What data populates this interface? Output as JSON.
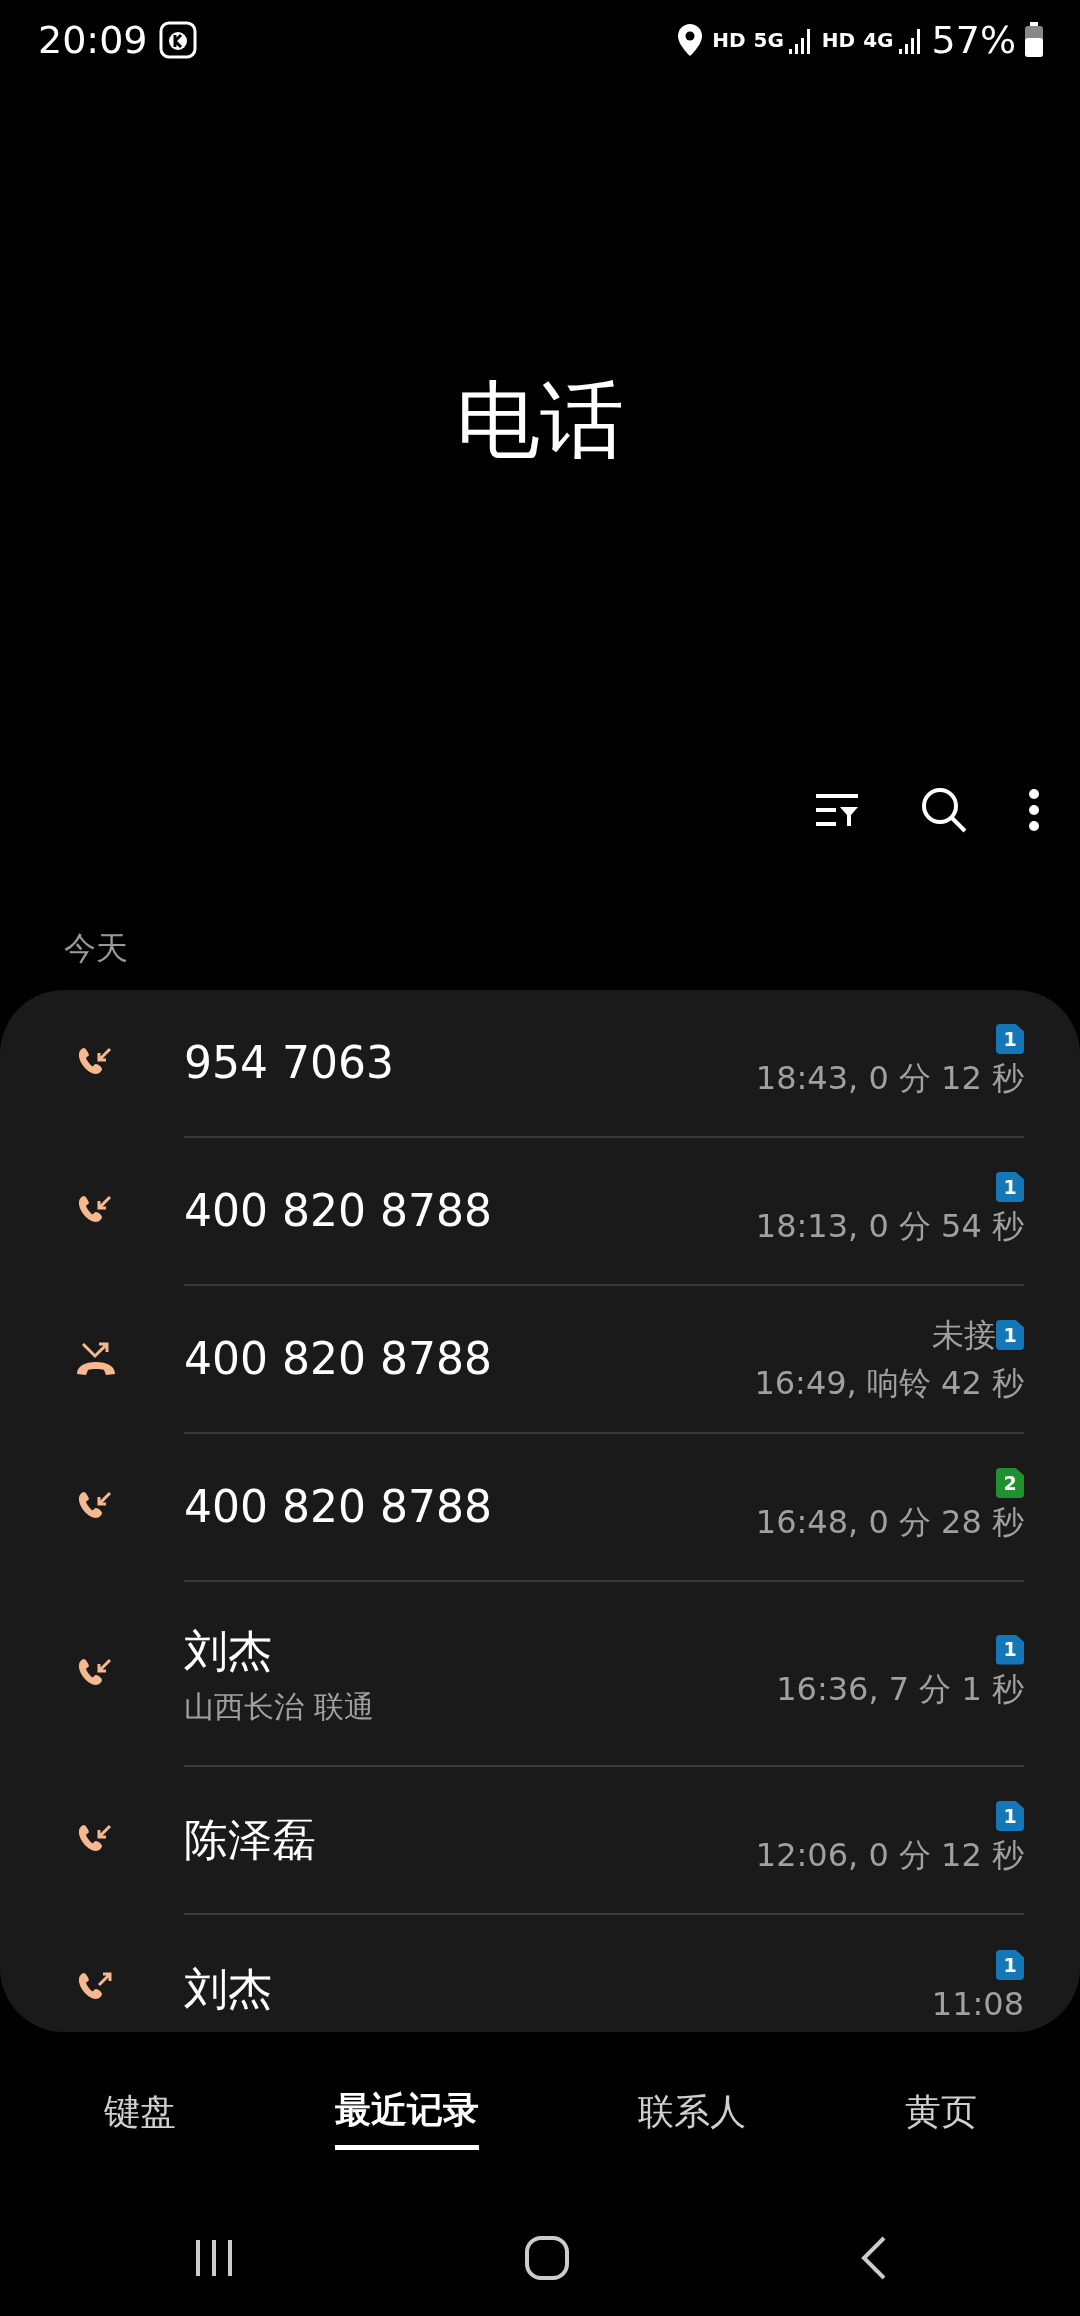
{
  "status_bar": {
    "time": "20:09",
    "network": [
      {
        "label": "HD",
        "kind": "hd"
      },
      {
        "label": "5G",
        "kind": "signal"
      },
      {
        "label": "HD",
        "kind": "hd"
      },
      {
        "label": "4G",
        "kind": "signal"
      }
    ],
    "battery": "57%"
  },
  "title": "电话",
  "section": "今天",
  "calls": [
    {
      "kind": "incoming",
      "name": "954 7063",
      "sim": "1",
      "color": "#1478b8",
      "time": "18:43, 0 分 12 秒"
    },
    {
      "kind": "incoming",
      "name": "400 820 8788",
      "sim": "1",
      "color": "#1478b8",
      "time": "18:13, 0 分 54 秒"
    },
    {
      "kind": "missed",
      "name": "400 820 8788",
      "status": "未接",
      "sim": "1",
      "color": "#1478b8",
      "time": "16:49, 响铃 42 秒"
    },
    {
      "kind": "incoming",
      "name": "400 820 8788",
      "sim": "2",
      "color": "#21902f",
      "time": "16:48, 0 分 28 秒"
    },
    {
      "kind": "incoming",
      "name": "刘杰",
      "location": "山西长治 联通",
      "sim": "1",
      "color": "#1478b8",
      "time": "16:36, 7 分 1 秒"
    },
    {
      "kind": "incoming",
      "name": "陈泽磊",
      "sim": "1",
      "color": "#1478b8",
      "time": "12:06, 0 分 12 秒"
    },
    {
      "kind": "outgoing",
      "name": "刘杰",
      "sim": "1",
      "color": "#1478b8",
      "time": "11:08"
    }
  ],
  "tabs": [
    {
      "label": "键盘",
      "selected": false
    },
    {
      "label": "最近记录",
      "selected": true
    },
    {
      "label": "联系人",
      "selected": false
    },
    {
      "label": "黄页",
      "selected": false
    }
  ]
}
